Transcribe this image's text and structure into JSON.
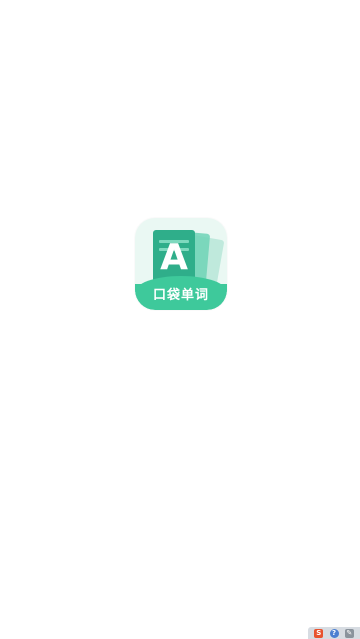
{
  "splash": {
    "app_icon": {
      "letter": "A",
      "label": "口袋单词",
      "colors": {
        "background": "#eaf8f3",
        "card_front": "#2fae8a",
        "card_mid": "#6fd3b6",
        "card_back": "#bfe9dc",
        "label_band": "#3ec99b"
      }
    }
  },
  "system_tray": {
    "icons": [
      "sogou-ime-icon",
      "help-icon",
      "pen-icon"
    ],
    "ime_glyph": "S",
    "help_glyph": "?",
    "pen_glyph": "✎"
  }
}
